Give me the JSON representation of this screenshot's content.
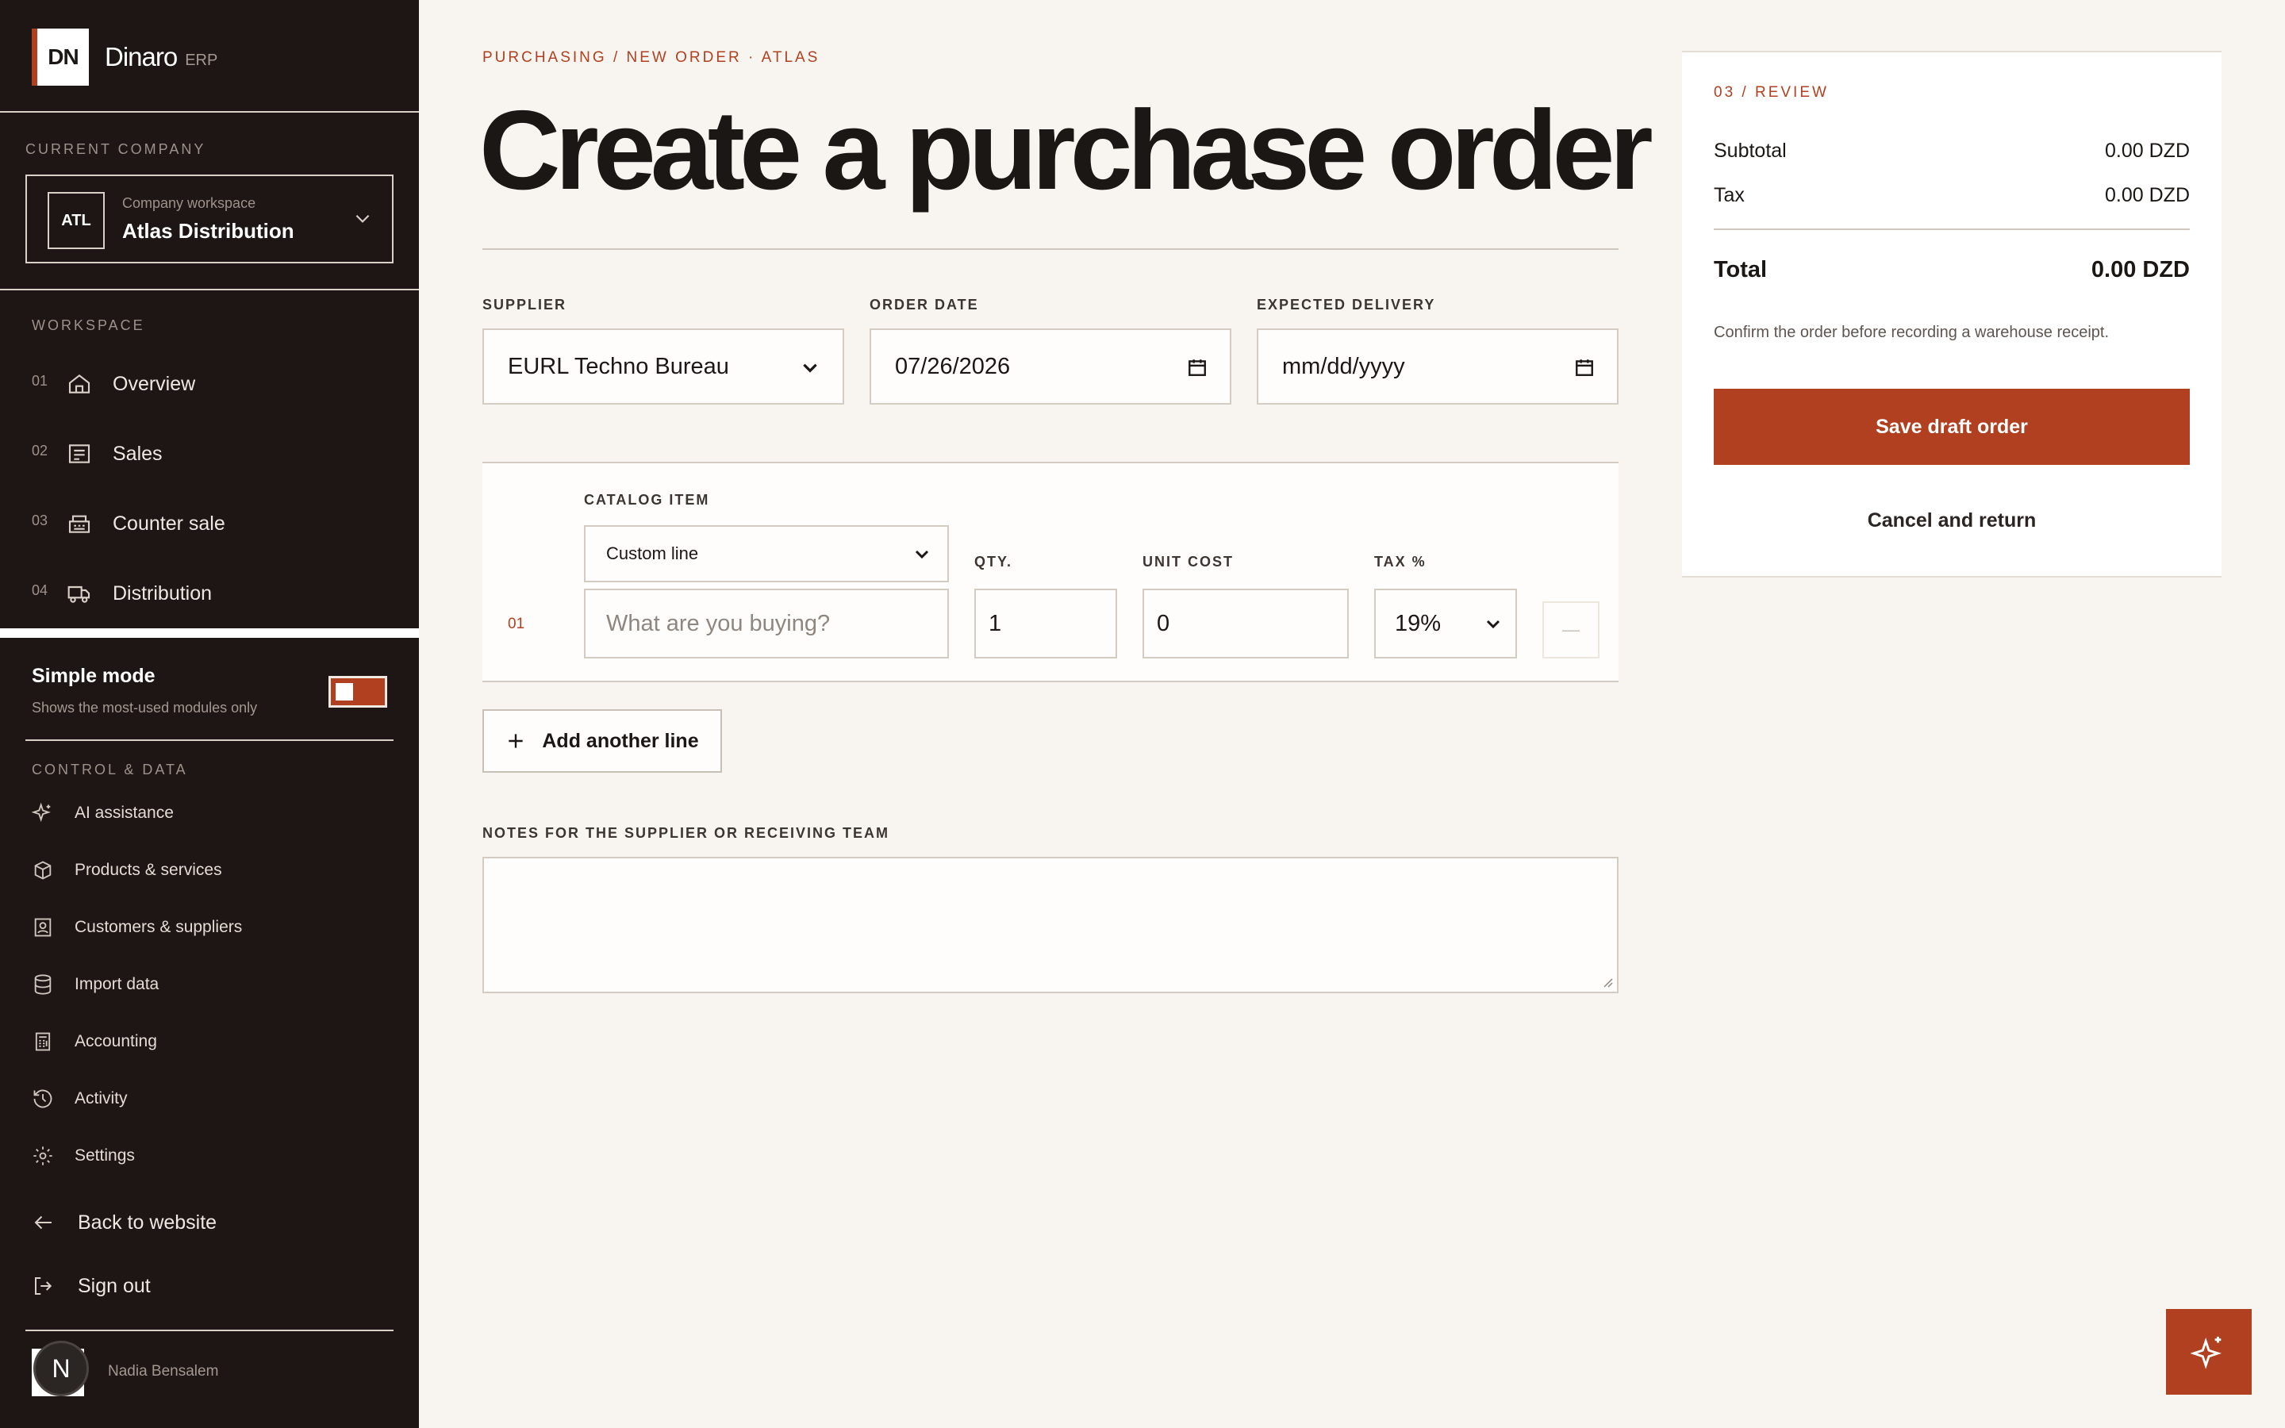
{
  "brand": {
    "mark": "DN",
    "name": "Dinaro",
    "suffix": "ERP"
  },
  "company": {
    "section_label": "CURRENT COMPANY",
    "badge": "ATL",
    "caption": "Company workspace",
    "name": "Atlas Distribution"
  },
  "workspace": {
    "section_label": "WORKSPACE",
    "items": [
      {
        "num": "01",
        "label": "Overview",
        "icon": "home-icon"
      },
      {
        "num": "02",
        "label": "Sales",
        "icon": "receipt-icon"
      },
      {
        "num": "03",
        "label": "Counter sale",
        "icon": "register-icon"
      },
      {
        "num": "04",
        "label": "Distribution",
        "icon": "truck-icon"
      }
    ]
  },
  "simple_mode": {
    "title": "Simple mode",
    "subtitle": "Shows the most-used modules only",
    "enabled": true
  },
  "control": {
    "section_label": "CONTROL & DATA",
    "items": [
      {
        "label": "AI assistance",
        "icon": "sparkle-icon"
      },
      {
        "label": "Products & services",
        "icon": "box-icon"
      },
      {
        "label": "Customers & suppliers",
        "icon": "contact-icon"
      },
      {
        "label": "Import data",
        "icon": "database-icon"
      },
      {
        "label": "Accounting",
        "icon": "calculator-icon"
      },
      {
        "label": "Activity",
        "icon": "history-icon"
      },
      {
        "label": "Settings",
        "icon": "gear-icon"
      }
    ]
  },
  "footer": {
    "back": "Back to website",
    "signout": "Sign out",
    "user_initial": "N",
    "user_name": "Nadia Bensalem"
  },
  "main": {
    "breadcrumb": "PURCHASING / NEW ORDER · ATLAS",
    "title": "Create a purchase order",
    "supplier_label": "SUPPLIER",
    "supplier_value": "EURL Techno Bureau",
    "order_date_label": "ORDER DATE",
    "order_date_value": "07/26/2026",
    "delivery_label": "EXPECTED DELIVERY",
    "delivery_placeholder": "mm/dd/yyyy",
    "line": {
      "num": "01",
      "catalog_label": "CATALOG ITEM",
      "catalog_value": "Custom line",
      "description_placeholder": "What are you buying?",
      "qty_label": "QTY.",
      "qty_value": "1",
      "unit_cost_label": "UNIT COST",
      "unit_cost_value": "0",
      "tax_label": "TAX %",
      "tax_value": "19%",
      "remove_glyph": "—"
    },
    "add_line": "Add another line",
    "notes_label": "NOTES FOR THE SUPPLIER OR RECEIVING TEAM",
    "notes_value": ""
  },
  "review": {
    "tag": "03 / REVIEW",
    "subtotal_label": "Subtotal",
    "subtotal_value": "0.00 DZD",
    "tax_label": "Tax",
    "tax_value": "0.00 DZD",
    "total_label": "Total",
    "total_value": "0.00 DZD",
    "note": "Confirm the order before recording a warehouse receipt.",
    "save": "Save draft order",
    "cancel": "Cancel and return"
  },
  "colors": {
    "accent": "#b0401f",
    "sidebar": "#1e1614",
    "page": "#f8f5f0"
  }
}
